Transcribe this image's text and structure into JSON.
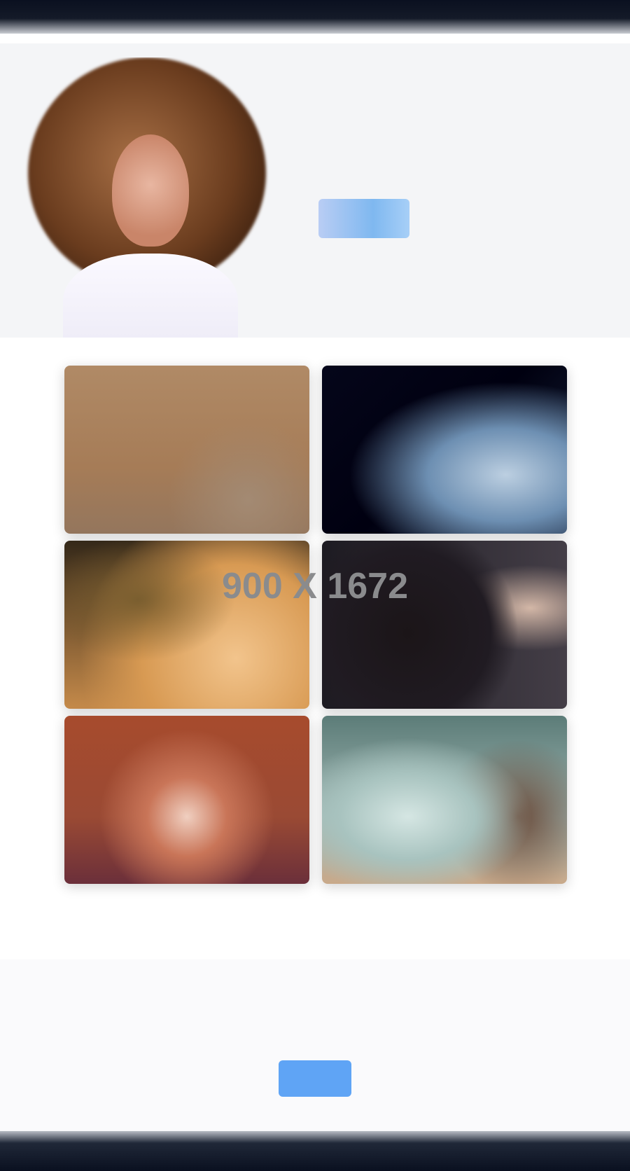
{
  "header": {
    "label": ""
  },
  "profile": {
    "name": "",
    "tagline": "",
    "button_label": "",
    "portrait_icon": "person-portrait-photo"
  },
  "gallery": {
    "tiles": [
      {
        "icon": "photo-warm-beige"
      },
      {
        "icon": "photo-dark-blue"
      },
      {
        "icon": "photo-golden-food"
      },
      {
        "icon": "photo-dark-figure"
      },
      {
        "icon": "photo-red-orange"
      },
      {
        "icon": "photo-teal-still-life"
      }
    ]
  },
  "placeholder_size_label": "900 X 1672",
  "cta": {
    "heading": "",
    "button_label": ""
  },
  "footer": {
    "label": ""
  },
  "colors": {
    "accent": "#5fa4f5",
    "topbar": "#0a1020",
    "profile_background": "#f4f5f7",
    "footer": "#0a1020"
  }
}
